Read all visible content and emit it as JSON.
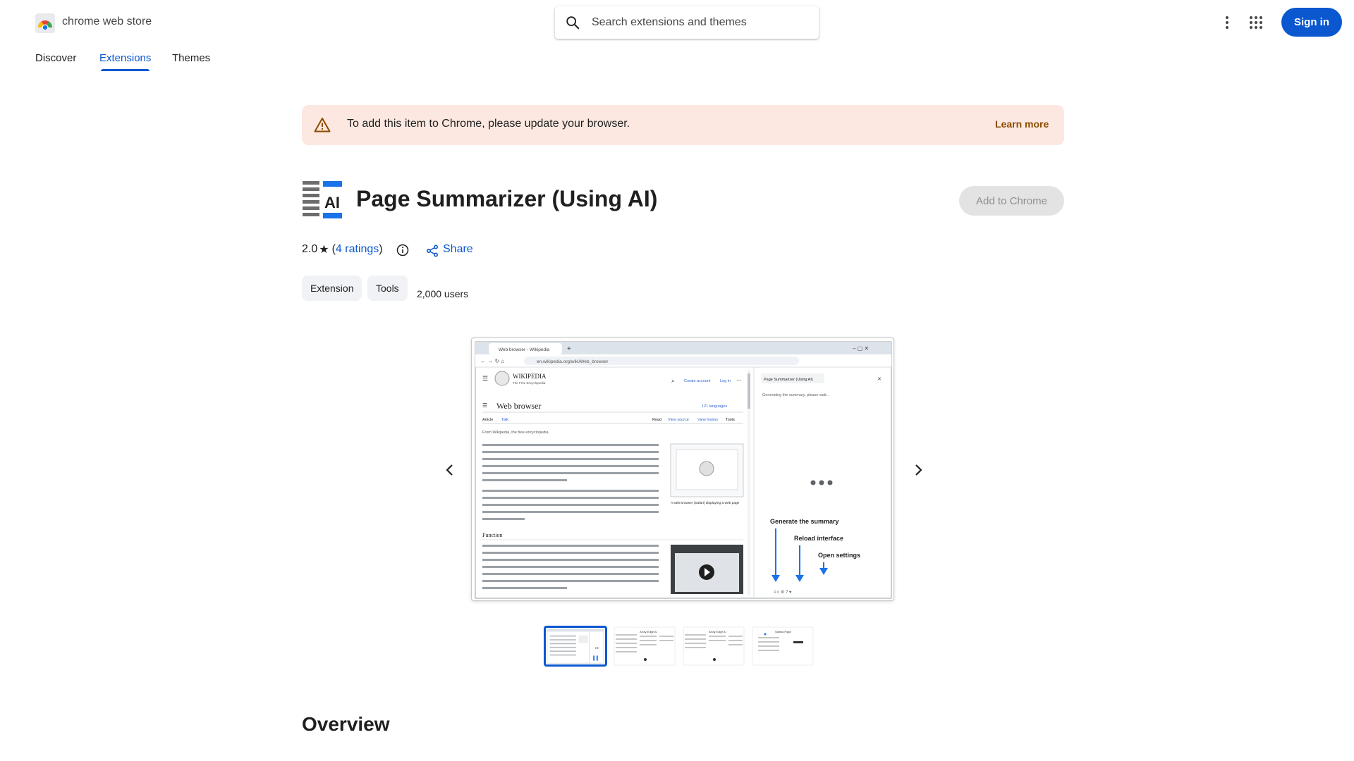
{
  "header": {
    "brand": "chrome web store",
    "search_placeholder": "Search extensions and themes",
    "signin_label": "Sign in"
  },
  "nav": {
    "tabs": [
      {
        "label": "Discover",
        "active": false
      },
      {
        "label": "Extensions",
        "active": true
      },
      {
        "label": "Themes",
        "active": false
      }
    ]
  },
  "banner": {
    "message": "To add this item to Chrome, please update your browser.",
    "link": "Learn more"
  },
  "item": {
    "title": "Page Summarizer (Using AI)",
    "add_button": "Add to Chrome",
    "rating": "2.0",
    "ratings_count": "4 ratings",
    "share": "Share",
    "chips": [
      "Extension",
      "Tools"
    ],
    "users": "2,000 users",
    "icon_text": "AI"
  },
  "screenshot": {
    "tab_title": "Web browser - Wikipedia",
    "url": "en.wikipedia.org/wiki/Web_browser",
    "wiki_brand": "WIKIPEDIA",
    "wiki_tagline": "The Free Encyclopedia",
    "create_account": "Create account",
    "log_in": "Log in",
    "article_title": "Web browser",
    "languages": "121 languages",
    "tabs_left": [
      "Article",
      "Talk"
    ],
    "tabs_right": [
      "Read",
      "View source",
      "View history",
      "Tools"
    ],
    "from": "From Wikipedia, the free encyclopedia",
    "section": "Function",
    "caption": "A web browser (Safari) displaying a web page",
    "panel_title": "Page Summarizer (Using AI)",
    "panel_status": "Generating the summary, please wait...",
    "annotations": [
      "Generate the summary",
      "Reload interface",
      "Open settings"
    ]
  },
  "thumbs": {
    "count": 4,
    "active_index": 0,
    "labels": [
      "",
      "Array Edge AI",
      "Array Edge AI",
      "Saltina Page"
    ]
  },
  "overview_title": "Overview",
  "colors": {
    "accent": "#0b57d0",
    "banner_bg": "#fce8e0",
    "banner_link": "#8c4a00"
  }
}
